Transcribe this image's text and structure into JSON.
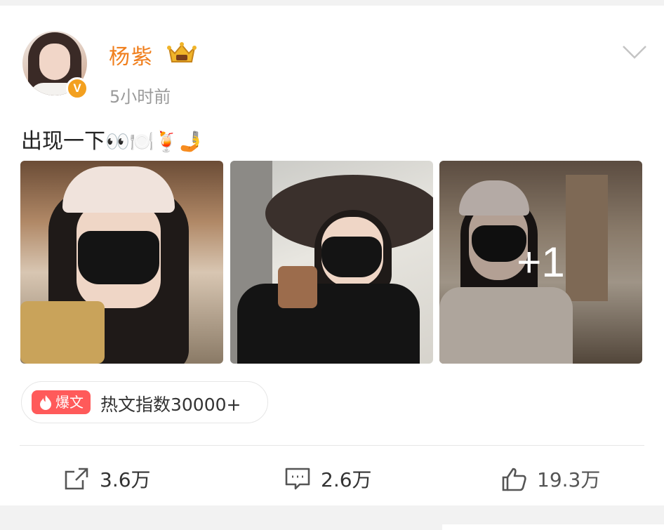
{
  "post": {
    "username": "杨紫",
    "timestamp": "5小时前",
    "text": "出现一下",
    "emojis": "👀🍽️🍹🤳",
    "verified_badge": "V",
    "more_photos": "+1",
    "hot_tag": "爆文",
    "hot_index": "热文指数30000+"
  },
  "actions": {
    "share_count": "3.6万",
    "comment_count": "2.6万",
    "like_count": "19.3万"
  },
  "icons": {
    "menu": "chevron-down-icon",
    "crown": "crown-icon",
    "share": "share-icon",
    "comment": "comment-icon",
    "like": "thumbs-up-icon",
    "hot": "flame-icon"
  },
  "colors": {
    "username": "#f07f1d",
    "verified": "#f3a01f",
    "hot_tag_bg": "#ff5a5a",
    "timestamp": "#9a9a9a"
  }
}
